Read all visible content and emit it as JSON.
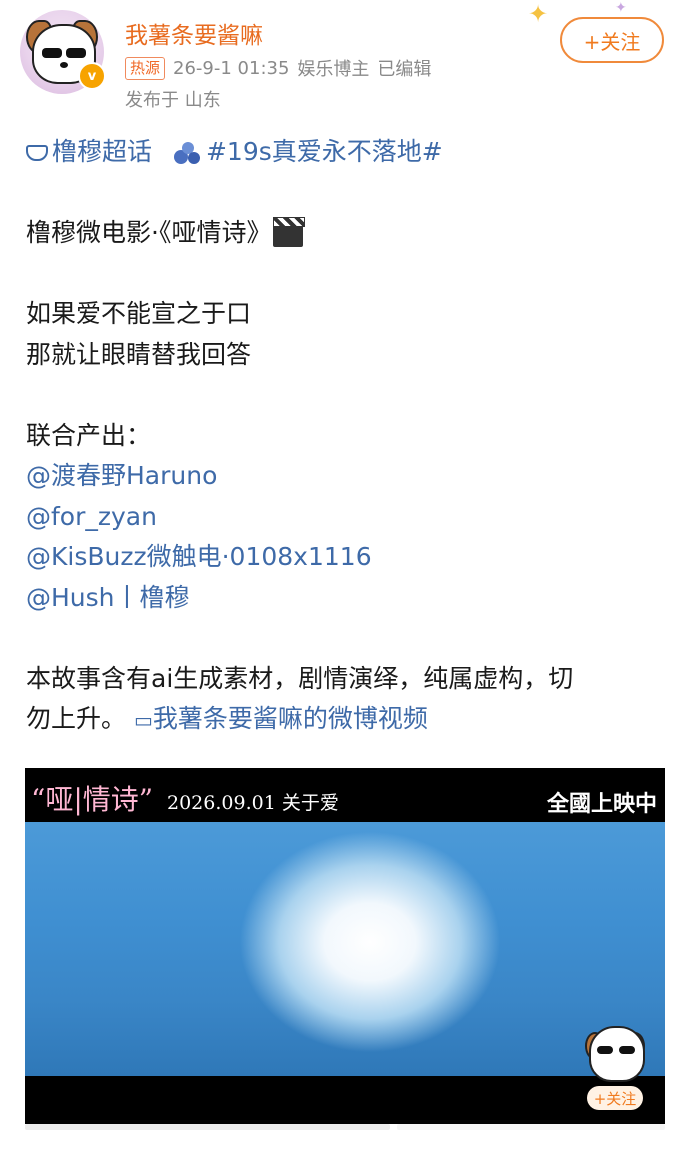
{
  "header": {
    "username": "我薯条要酱嘛",
    "hot_tag": "热源",
    "datetime": "26-9-1 01:35",
    "role": "娱乐博主",
    "edited": "已编辑",
    "location": "发布于 山东",
    "follow_label": "+关注",
    "verified_mark": "v"
  },
  "post": {
    "topic_super": "橹穆超话",
    "hashtag": "#19s真爱永不落地#",
    "title": "橹穆微电影·《哑情诗》",
    "line1": "如果爱不能宣之于口",
    "line2": "那就让眼睛替我回答",
    "credits_label": "联合产出：",
    "mentions": [
      "@渡春野Haruno",
      "@for_zyan",
      "@KisBuzz微触电·0108x1116",
      "@Hush丨橹穆"
    ],
    "disclaimer1": "本故事含有ai生成素材，剧情演绎，纯属虚构，切",
    "disclaimer2": "勿上升。",
    "video_link": "我薯条要酱嘛的微博视频"
  },
  "video": {
    "title_overlay": "“哑|情诗”",
    "date_overlay": "2026.09.01 关于爱",
    "right_overlay": "全國上映中",
    "follow_label": "+关注"
  },
  "colors": {
    "accent_orange": "#f07a1e",
    "link_blue": "#3e6aa8",
    "username_orange": "#e86b1f"
  }
}
